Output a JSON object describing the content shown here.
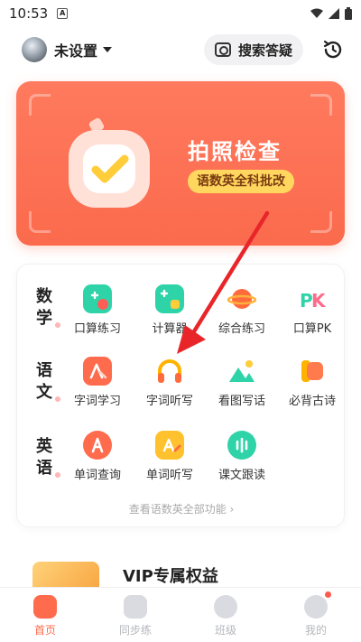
{
  "status_bar": {
    "time": "10:53",
    "a_icon": "A"
  },
  "header": {
    "username": "未设置",
    "search_label": "搜索答疑"
  },
  "photo_card": {
    "title": "拍照检查",
    "subtitle": "语数英全科批改"
  },
  "subjects": {
    "math": "数学",
    "chinese": "语文",
    "english": "英语"
  },
  "features": {
    "math": [
      {
        "label": "口算练习",
        "icon": "calc-practice-icon"
      },
      {
        "label": "计算器",
        "icon": "calculator-icon"
      },
      {
        "label": "综合练习",
        "icon": "planet-icon"
      },
      {
        "label": "口算PK",
        "icon": "pk-icon"
      }
    ],
    "chinese": [
      {
        "label": "字词学习",
        "icon": "character-icon"
      },
      {
        "label": "字词听写",
        "icon": "headphone-icon"
      },
      {
        "label": "看图写话",
        "icon": "picture-icon"
      },
      {
        "label": "必背古诗",
        "icon": "poem-icon"
      }
    ],
    "english": [
      {
        "label": "单词查询",
        "icon": "word-lookup-icon"
      },
      {
        "label": "单词听写",
        "icon": "word-dictation-icon"
      },
      {
        "label": "课文跟读",
        "icon": "read-along-icon"
      }
    ],
    "more_link": "查看语数英全部功能 ›"
  },
  "vip": {
    "title": "VIP专属权益"
  },
  "tabbar": {
    "items": [
      {
        "label": "首页",
        "active": true
      },
      {
        "label": "同步练",
        "active": false
      },
      {
        "label": "班级",
        "active": false
      },
      {
        "label": "我的",
        "active": false
      }
    ]
  },
  "colors": {
    "accent": "#fb6a4d",
    "badge": "#ffd75e",
    "arrow": "#e8262a"
  }
}
